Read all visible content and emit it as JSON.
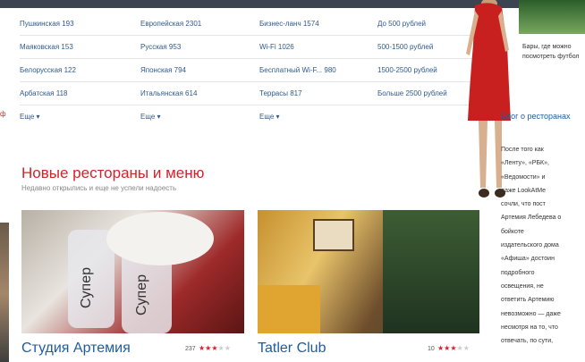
{
  "filters": {
    "col1": [
      "Пушкинская 193",
      "Маяковская 153",
      "Белорусская 122",
      "Арбатская 118"
    ],
    "col2": [
      "Европейская 2301",
      "Русская 953",
      "Японская 794",
      "Итальянская 614"
    ],
    "col3": [
      "Бизнес-ланч 1574",
      "Wi-Fi 1026",
      "Бесплатный Wi-F... 980",
      "Террасы 817"
    ],
    "col4": [
      "До 500 рублей",
      "500-1500 рублей",
      "1500-2500 рублей",
      "Больше 2500 рублей"
    ],
    "more_label": "Еще"
  },
  "new": {
    "title": "Новые рестораны и меню",
    "subtitle": "Недавно открылись и еще не успели надоесть"
  },
  "cards": [
    {
      "title": "Студия Артемия",
      "count": "237",
      "rating": 3,
      "rating_max": 5,
      "glass_text": "Супер"
    },
    {
      "title": "Tatler Club",
      "count": "10",
      "rating": 3,
      "rating_max": 5
    }
  ],
  "promo": {
    "text": "Бары, где можно посмотреть футбол"
  },
  "blog": {
    "title": "Блог о ресторанах",
    "lines": [
      "После того как",
      "«Ленту», «РБК»,",
      "«Ведомости» и",
      "даже LookAtMe",
      "сочли, что пост",
      "Артемия Лебедева о",
      "бойкоте",
      "издательского дома",
      "«Афиша» достоин",
      "подробного",
      "освещения, не",
      "ответить Артемию",
      "невозможно — даже",
      "несмотря на то, что",
      "отвечать, по сути,"
    ]
  },
  "colors": {
    "accent": "#d2232a",
    "link": "#2f5a8c"
  }
}
